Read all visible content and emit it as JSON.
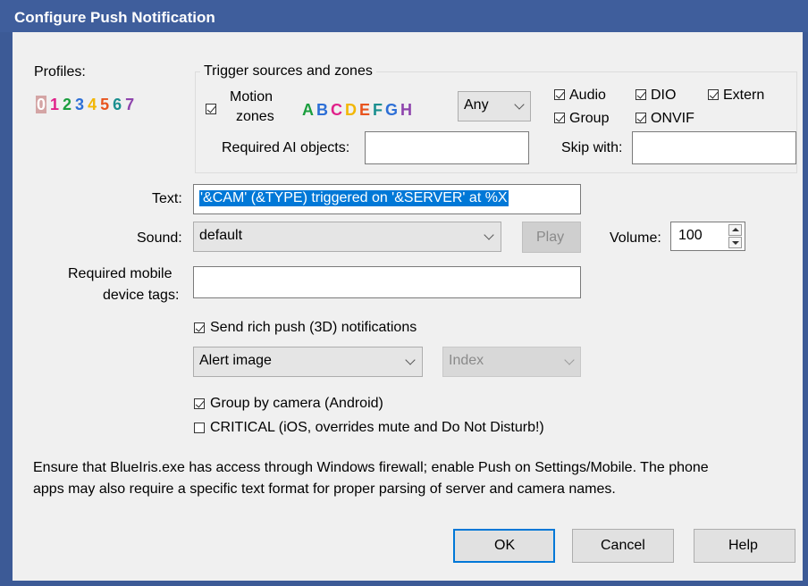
{
  "window": {
    "title": "Configure Push Notification"
  },
  "profiles": {
    "label": "Profiles:",
    "digits": [
      {
        "t": "0",
        "color": "#ffffff",
        "bg": "#d4a5a5"
      },
      {
        "t": "1",
        "color": "#e0218a"
      },
      {
        "t": "2",
        "color": "#1b9e3e"
      },
      {
        "t": "3",
        "color": "#2d6fd6"
      },
      {
        "t": "4",
        "color": "#f2b705"
      },
      {
        "t": "5",
        "color": "#e8541e"
      },
      {
        "t": "6",
        "color": "#1a8f8f"
      },
      {
        "t": "7",
        "color": "#8e44ad"
      }
    ]
  },
  "trigger": {
    "group_label": "Trigger sources and zones",
    "motion_zones_line1": "Motion",
    "motion_zones_line2": "zones",
    "zones": [
      {
        "t": "A",
        "color": "#1b9e3e"
      },
      {
        "t": "B",
        "color": "#2d6fd6"
      },
      {
        "t": "C",
        "color": "#e0218a"
      },
      {
        "t": "D",
        "color": "#f2b705"
      },
      {
        "t": "E",
        "color": "#e8541e"
      },
      {
        "t": "F",
        "color": "#1a8f8f"
      },
      {
        "t": "G",
        "color": "#2d6fd6"
      },
      {
        "t": "H",
        "color": "#8e44ad"
      }
    ],
    "zone_select": "Any",
    "audio": "Audio",
    "dio": "DIO",
    "extern": "Extern",
    "group": "Group",
    "onvif": "ONVIF",
    "required_ai_label": "Required AI objects:",
    "required_ai_value": "",
    "skip_with_label": "Skip with:",
    "skip_with_value": ""
  },
  "text": {
    "label": "Text:",
    "value": "'&CAM' (&TYPE) triggered on '&SERVER' at %X"
  },
  "sound": {
    "label": "Sound:",
    "value": "default",
    "play": "Play",
    "volume_label": "Volume:",
    "volume_value": "100"
  },
  "tags": {
    "label_line1": "Required mobile",
    "label_line2": "device tags:",
    "value": ""
  },
  "rich_push": {
    "label": "Send rich push (3D) notifications",
    "image_select": "Alert image",
    "index_select": "Index"
  },
  "group_by_camera": "Group by camera (Android)",
  "critical": "CRITICAL (iOS, overrides mute and Do Not Disturb!)",
  "info_line1": "Ensure that BlueIris.exe has access through Windows firewall; enable Push on Settings/Mobile.  The phone",
  "info_line2": "apps may also require a specific text format for proper parsing of server and camera names.",
  "buttons": {
    "ok": "OK",
    "cancel": "Cancel",
    "help": "Help"
  }
}
